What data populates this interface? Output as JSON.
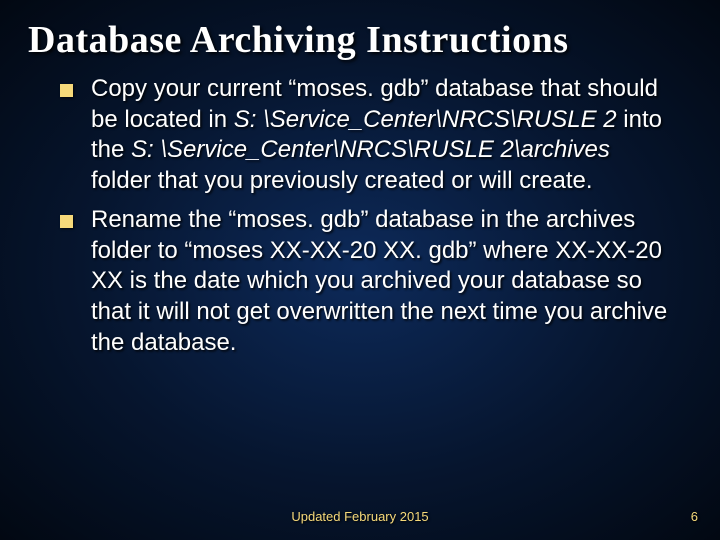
{
  "title": "Database Archiving Instructions",
  "bullets": [
    {
      "pre": "Copy your current “moses. gdb” database that should be located in ",
      "italic1": "S: \\Service_Center\\NRCS\\RUSLE 2",
      "mid": " into the ",
      "italic2": "S: \\Service_Center\\NRCS\\RUSLE 2\\archives",
      "post": " folder that you previously created or will create."
    },
    {
      "pre": "Rename the “moses. gdb” database in the archives folder to “moses XX-XX-20 XX. gdb” where XX-XX-20 XX is the date which you archived your database so that it will not get overwritten the next time you archive the database.",
      "italic1": "",
      "mid": "",
      "italic2": "",
      "post": ""
    }
  ],
  "footer": {
    "center": "Updated February 2015",
    "page": "6"
  }
}
